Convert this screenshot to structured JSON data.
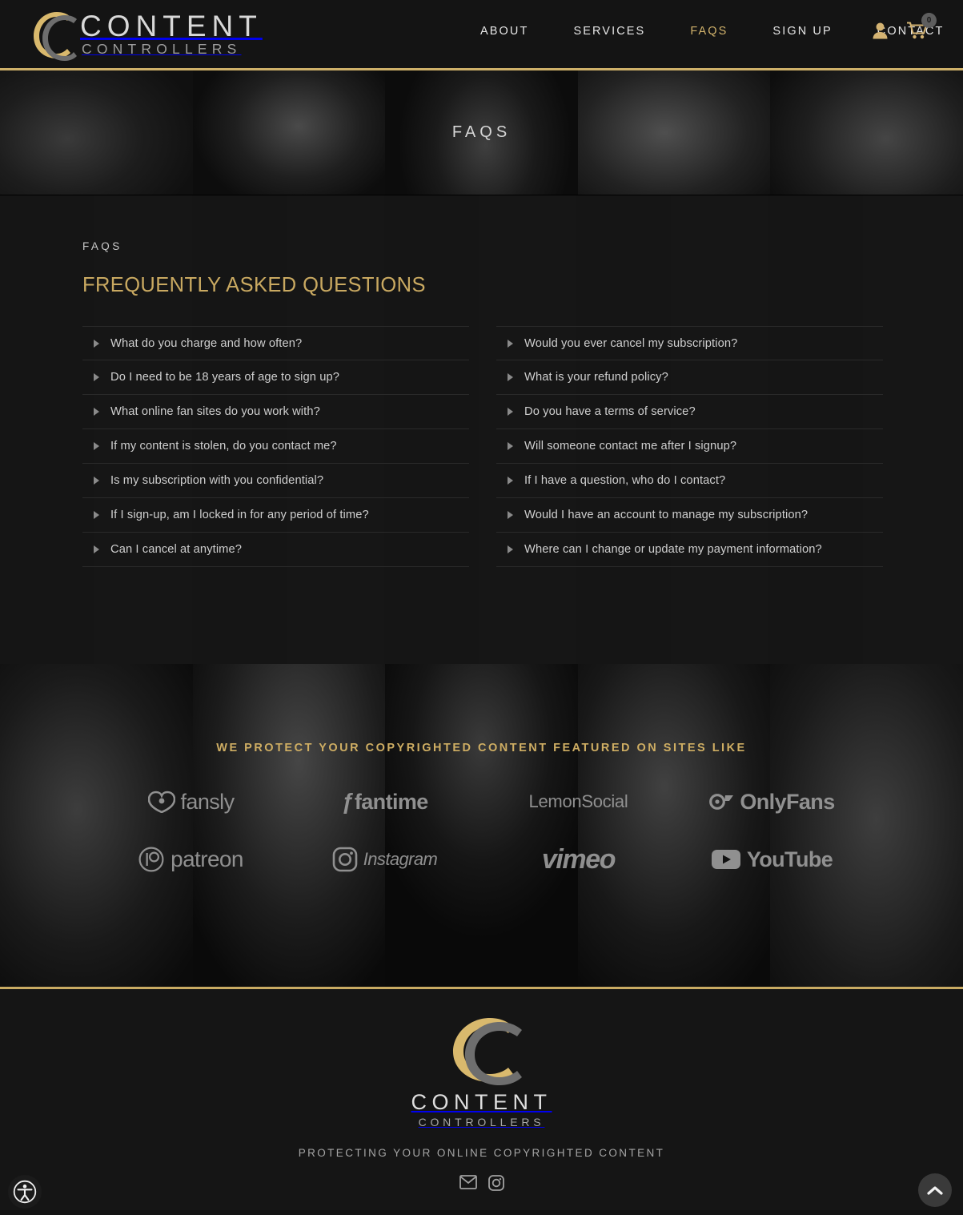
{
  "brand": {
    "name_line1": "CONTENT",
    "name_line2": "CONTROLLERS",
    "accent_gold": "#c9a961",
    "accent_gold_border": "#cfb16a"
  },
  "nav": {
    "items": [
      {
        "label": "ABOUT",
        "active": false
      },
      {
        "label": "SERVICES",
        "active": false
      },
      {
        "label": "FAQS",
        "active": true
      },
      {
        "label": "SIGN UP",
        "active": false
      },
      {
        "label": "CONTACT",
        "active": false
      }
    ],
    "account_icon": "user-icon",
    "cart_icon": "shopping-cart-icon",
    "cart_count": "0"
  },
  "hero": {
    "title": "FAQS"
  },
  "faq": {
    "eyebrow": "FAQS",
    "title": "FREQUENTLY ASKED QUESTIONS",
    "left_column": [
      "What do you charge and how often?",
      "Do I need to be 18 years of age to sign up?",
      "What online fan sites do you work with?",
      "If my content is stolen, do you contact me?",
      "Is my subscription with you confidential?",
      "If I sign-up, am I locked in for any period of time?",
      "Can I cancel at anytime?"
    ],
    "right_column": [
      "Would you ever cancel my subscription?",
      "What is your refund policy?",
      "Do you have a terms of service?",
      "Will someone contact me after I signup?",
      "If I have a question, who do I contact?",
      "Would I have an account to manage my subscription?",
      "Where can I change or update my payment information?"
    ]
  },
  "brands": {
    "heading": "WE PROTECT YOUR COPYRIGHTED CONTENT FEATURED ON SITES LIKE",
    "row1": [
      {
        "name": "fansly",
        "icon": "fansly-heart-icon"
      },
      {
        "name": "fantime",
        "icon": "fantime-icon"
      },
      {
        "name": "LemonSocial",
        "icon": "lemonsocial-icon"
      },
      {
        "name": "OnlyFans",
        "icon": "onlyfans-icon"
      }
    ],
    "row2": [
      {
        "name": "patreon",
        "icon": "patreon-icon"
      },
      {
        "name": "Instagram",
        "icon": "instagram-icon"
      },
      {
        "name": "vimeo",
        "icon": "vimeo-icon"
      },
      {
        "name": "YouTube",
        "icon": "youtube-icon"
      }
    ]
  },
  "footer": {
    "tagline": "PROTECTING YOUR ONLINE COPYRIGHTED CONTENT",
    "social": [
      {
        "name": "email-icon",
        "label": "Email"
      },
      {
        "name": "instagram-icon",
        "label": "Instagram"
      }
    ]
  },
  "floating": {
    "accessibility_label": "Accessibility",
    "scroll_top_label": "Scroll to top"
  }
}
